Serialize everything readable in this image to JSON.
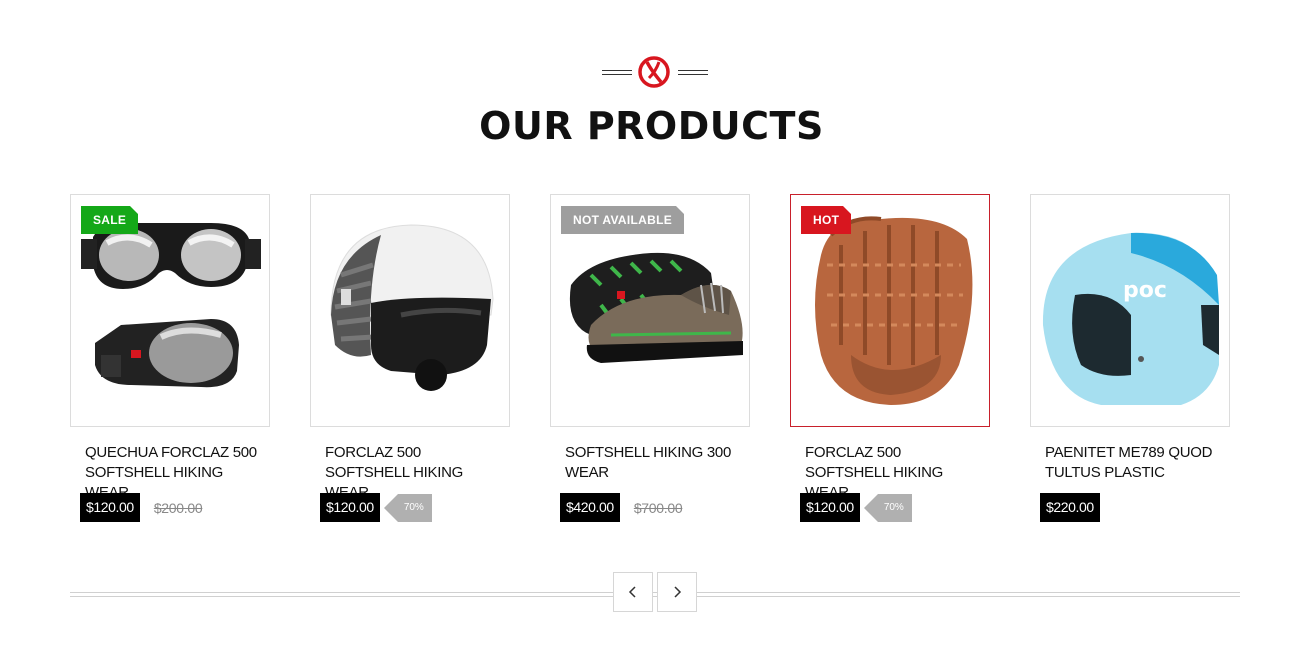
{
  "section": {
    "title": "OUR PRODUCTS"
  },
  "products": [
    {
      "badge": "SALE",
      "name": "QUECHUA FORCLAZ 500 SOFTSHELL HIKING WEAR",
      "price": "$120.00",
      "old_price": "$200.00",
      "discount": ""
    },
    {
      "badge": "",
      "name": "FORCLAZ 500 SOFTSHELL HIKING WEAR",
      "price": "$120.00",
      "old_price": "",
      "discount": "70%"
    },
    {
      "badge": "NOT AVAILABLE",
      "name": "SOFTSHELL HIKING 300 WEAR",
      "price": "$420.00",
      "old_price": "$700.00",
      "discount": ""
    },
    {
      "badge": "HOT",
      "name": "FORCLAZ 500 SOFTSHELL HIKING WEAR",
      "price": "$120.00",
      "old_price": "",
      "discount": "70%"
    },
    {
      "badge": "",
      "name": "PAENITET ME789 QUOD TULTUS PLASTIC",
      "price": "$220.00",
      "old_price": "",
      "discount": ""
    }
  ],
  "nav": {
    "prev_icon": "chevron-left-icon",
    "next_icon": "chevron-right-icon"
  },
  "colors": {
    "accent": "#d8161f",
    "sale_badge": "#14a818",
    "unavailable_badge": "#9e9e9e",
    "price_bg": "#000000"
  }
}
